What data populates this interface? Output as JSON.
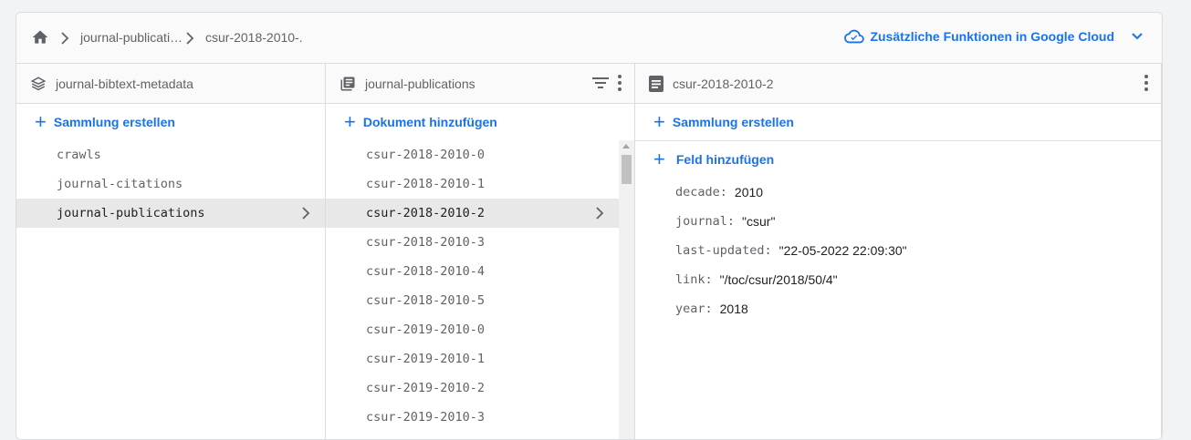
{
  "breadcrumb": {
    "items": [
      "journal-publicati…",
      "csur-2018-2010-."
    ],
    "cloud_link": "Zusätzliche Funktionen in Google Cloud"
  },
  "columns": {
    "root": {
      "title": "journal-bibtext-metadata",
      "add_label": "Sammlung erstellen",
      "items": [
        "crawls",
        "journal-citations",
        "journal-publications"
      ],
      "selected": "journal-publications"
    },
    "collection": {
      "title": "journal-publications",
      "add_label": "Dokument hinzufügen",
      "items": [
        "csur-2018-2010-0",
        "csur-2018-2010-1",
        "csur-2018-2010-2",
        "csur-2018-2010-3",
        "csur-2018-2010-4",
        "csur-2018-2010-5",
        "csur-2019-2010-0",
        "csur-2019-2010-1",
        "csur-2019-2010-2",
        "csur-2019-2010-3"
      ],
      "selected": "csur-2018-2010-2"
    },
    "document": {
      "title": "csur-2018-2010-2",
      "add_collection_label": "Sammlung erstellen",
      "add_field_label": "Feld hinzufügen",
      "fields": [
        {
          "key": "decade:",
          "value": "2010"
        },
        {
          "key": "journal:",
          "value": "\"csur\""
        },
        {
          "key": "last-updated:",
          "value": "\"22-05-2022 22:09:30\""
        },
        {
          "key": "link:",
          "value": "\"/toc/csur/2018/50/4\""
        },
        {
          "key": "year:",
          "value": "2018"
        }
      ]
    }
  },
  "colors": {
    "accent": "#1a73e8",
    "selected_bg": "#e8e8e8",
    "border": "#dadce0"
  }
}
